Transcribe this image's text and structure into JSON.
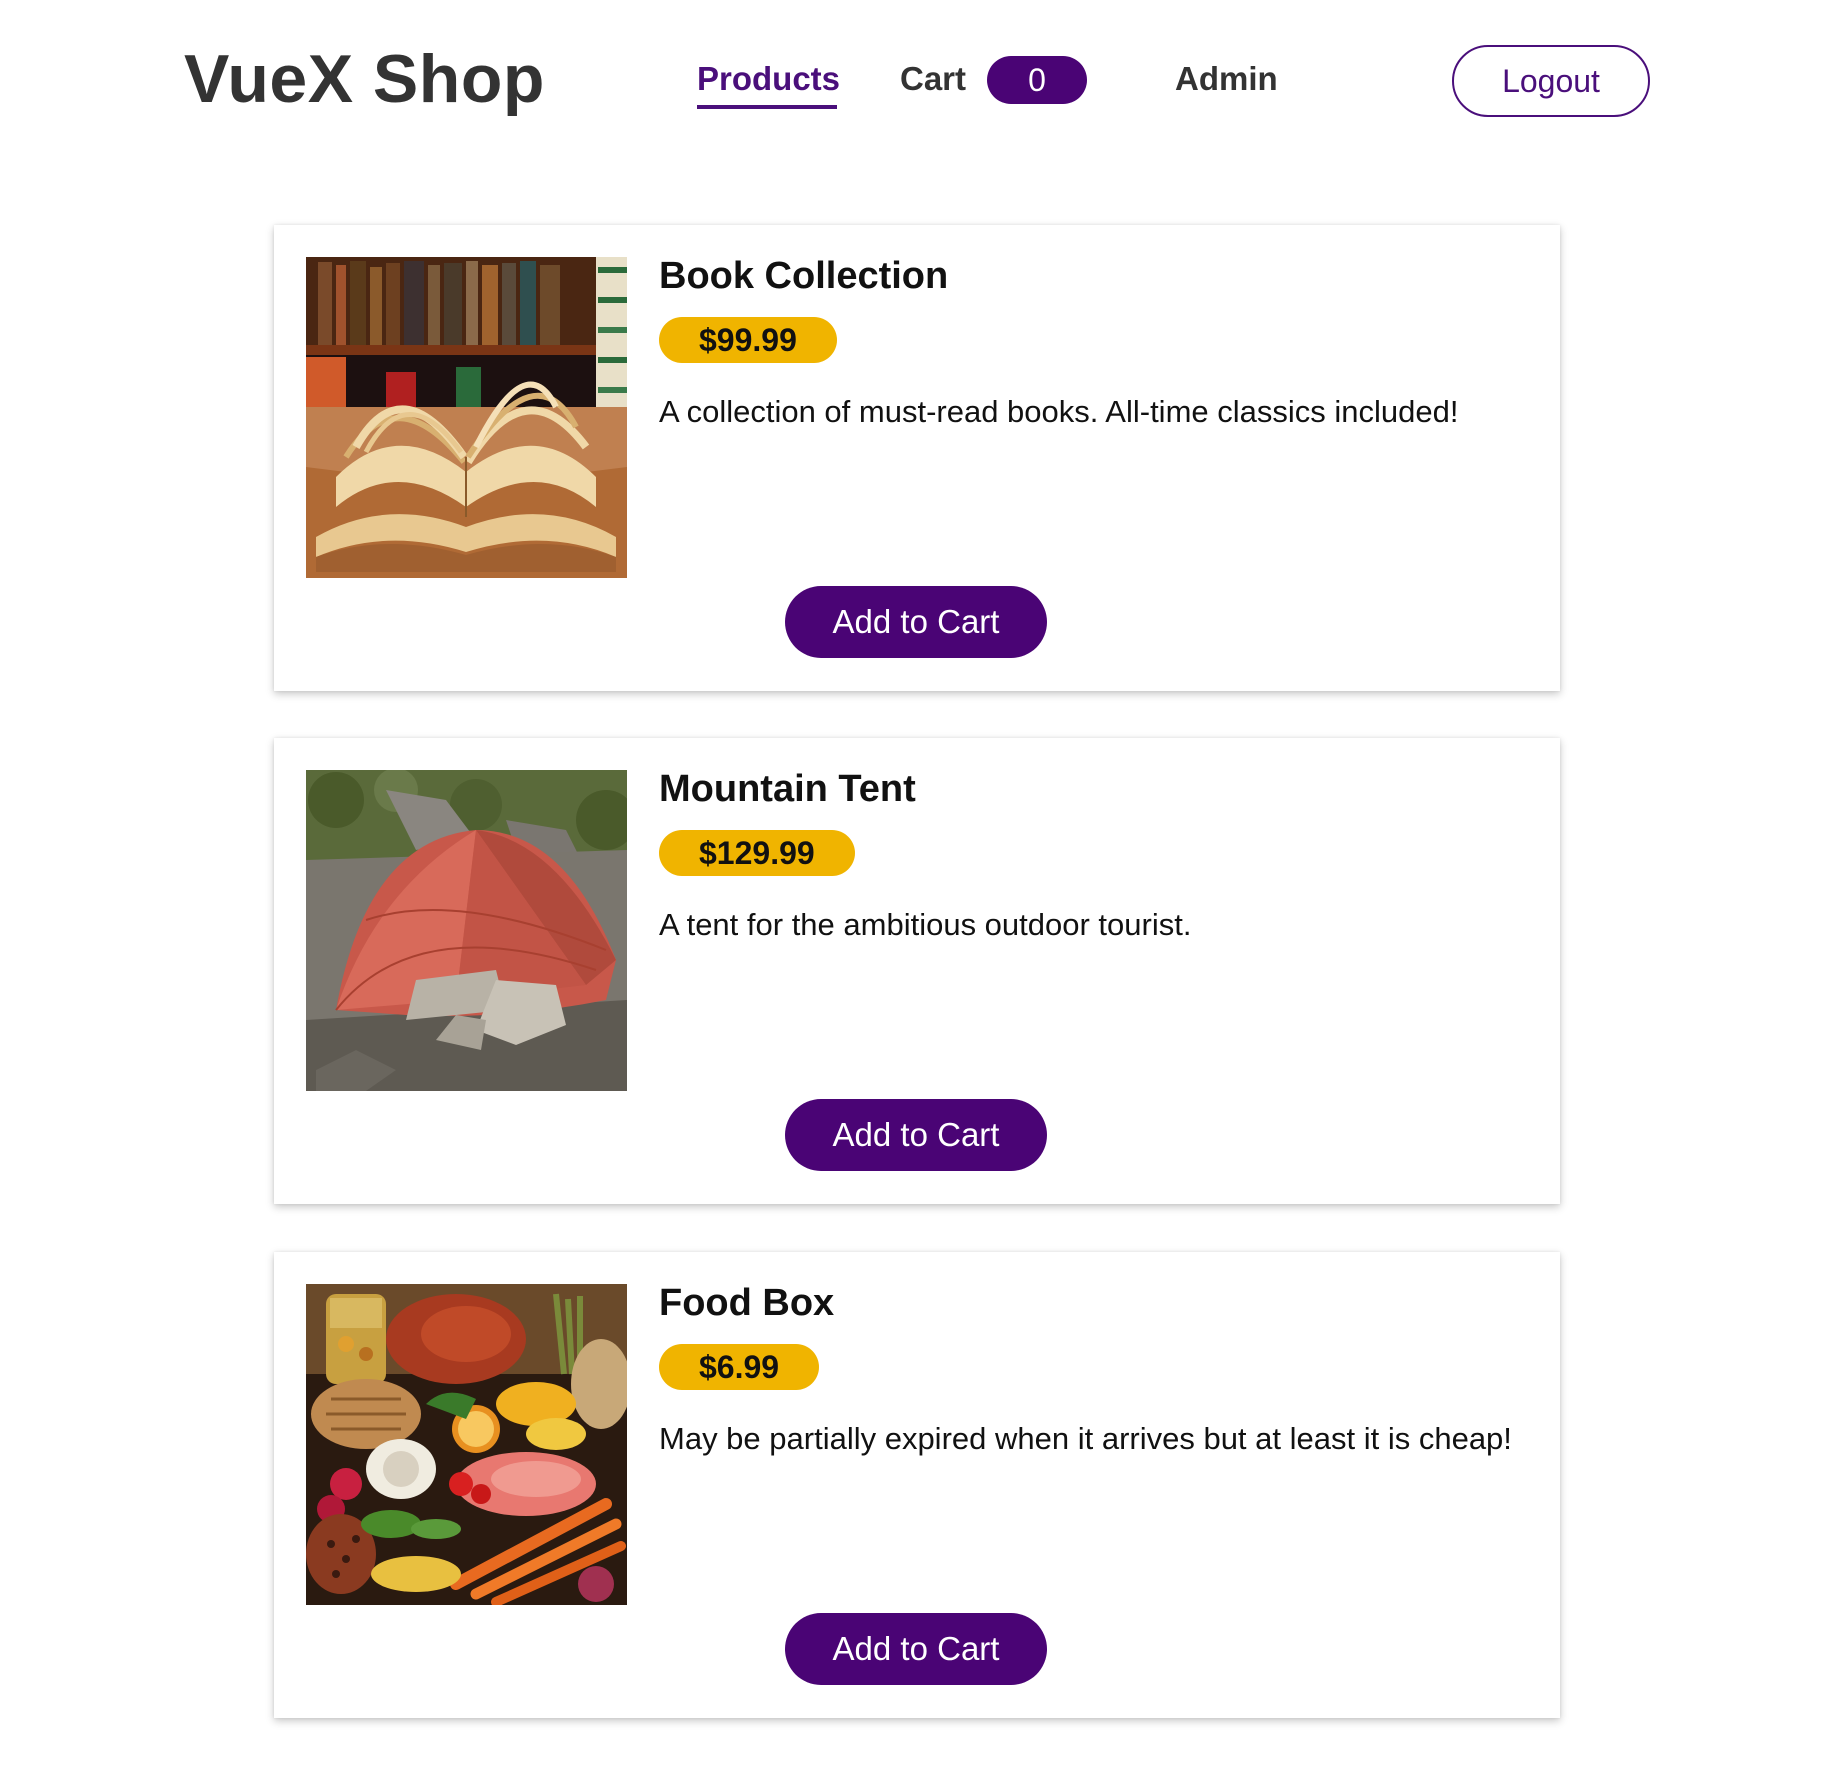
{
  "header": {
    "brand": "VueX Shop",
    "nav": {
      "products_label": "Products",
      "cart_label": "Cart",
      "cart_count": "0",
      "admin_label": "Admin"
    },
    "logout_label": "Logout"
  },
  "products": [
    {
      "title": "Book Collection",
      "price": "$99.99",
      "description": "A collection of must-read books. All-time classics included!",
      "button_label": "Add to Cart",
      "image": "open-books-photo"
    },
    {
      "title": "Mountain Tent",
      "price": "$129.99",
      "description": "A tent for the ambitious outdoor tourist.",
      "button_label": "Add to Cart",
      "image": "red-tent-on-rocks-photo"
    },
    {
      "title": "Food Box",
      "price": "$6.99",
      "description": "May be partially expired when it arrives but at least it is cheap!",
      "button_label": "Add to Cart",
      "image": "assorted-food-photo"
    }
  ],
  "colors": {
    "accent": "#4a0475",
    "price_badge": "#f0b400",
    "text": "#111111"
  }
}
